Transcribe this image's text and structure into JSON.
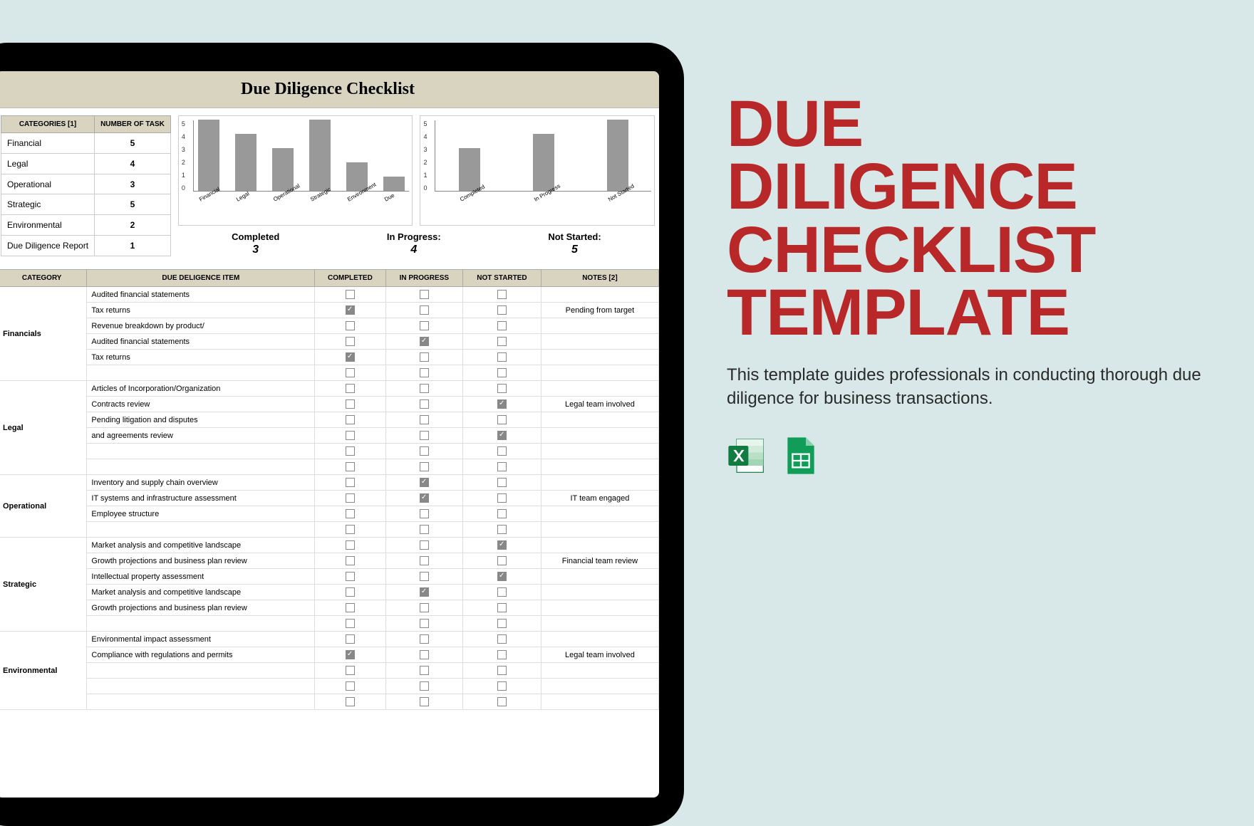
{
  "sheet": {
    "title": "Due Diligence Checklist",
    "summary": {
      "headers": [
        "CATEGORIES [1]",
        "NUMBER OF TASK"
      ],
      "rows": [
        {
          "cat": "Financial",
          "n": "5"
        },
        {
          "cat": "Legal",
          "n": "4"
        },
        {
          "cat": "Operational",
          "n": "3"
        },
        {
          "cat": "Strategic",
          "n": "5"
        },
        {
          "cat": "Environmental",
          "n": "2"
        },
        {
          "cat": "Due Diligence Report",
          "n": "1"
        }
      ]
    },
    "status": {
      "completed": {
        "label": "Completed",
        "val": "3"
      },
      "in_progress": {
        "label": "In Progress:",
        "val": "4"
      },
      "not_started": {
        "label": "Not Started:",
        "val": "5"
      }
    },
    "main_headers": [
      "CATEGORY",
      "DUE DELIGENCE ITEM",
      "COMPLETED",
      "IN PROGRESS",
      "NOT STARTED",
      "NOTES [2]"
    ],
    "groups": [
      {
        "name": "Financials",
        "rows": [
          {
            "item": "Audited financial statements",
            "c": false,
            "p": false,
            "n": false,
            "note": ""
          },
          {
            "item": "Tax returns",
            "c": true,
            "p": false,
            "n": false,
            "note": "Pending from target"
          },
          {
            "item": "Revenue breakdown by product/",
            "c": false,
            "p": false,
            "n": false,
            "note": ""
          },
          {
            "item": "Audited financial statements",
            "c": false,
            "p": true,
            "n": false,
            "note": ""
          },
          {
            "item": "Tax returns",
            "c": true,
            "p": false,
            "n": false,
            "note": ""
          },
          {
            "item": "",
            "c": false,
            "p": false,
            "n": false,
            "note": ""
          }
        ]
      },
      {
        "name": "Legal",
        "rows": [
          {
            "item": "Articles of Incorporation/Organization",
            "c": false,
            "p": false,
            "n": false,
            "note": ""
          },
          {
            "item": "Contracts review",
            "c": false,
            "p": false,
            "n": true,
            "note": "Legal team involved"
          },
          {
            "item": "Pending litigation and disputes",
            "c": false,
            "p": false,
            "n": false,
            "note": ""
          },
          {
            "item": "and agreements review",
            "c": false,
            "p": false,
            "n": true,
            "note": ""
          },
          {
            "item": "",
            "c": false,
            "p": false,
            "n": false,
            "note": ""
          },
          {
            "item": "",
            "c": false,
            "p": false,
            "n": false,
            "note": ""
          }
        ]
      },
      {
        "name": "Operational",
        "rows": [
          {
            "item": "Inventory and supply chain overview",
            "c": false,
            "p": true,
            "n": false,
            "note": ""
          },
          {
            "item": "IT systems and infrastructure assessment",
            "c": false,
            "p": true,
            "n": false,
            "note": "IT team engaged"
          },
          {
            "item": "Employee structure",
            "c": false,
            "p": false,
            "n": false,
            "note": ""
          },
          {
            "item": "",
            "c": false,
            "p": false,
            "n": false,
            "note": ""
          }
        ]
      },
      {
        "name": "Strategic",
        "rows": [
          {
            "item": "Market analysis and competitive landscape",
            "c": false,
            "p": false,
            "n": true,
            "note": ""
          },
          {
            "item": "Growth projections and business plan review",
            "c": false,
            "p": false,
            "n": false,
            "note": "Financial team review"
          },
          {
            "item": "Intellectual property assessment",
            "c": false,
            "p": false,
            "n": true,
            "note": ""
          },
          {
            "item": "Market analysis and competitive landscape",
            "c": false,
            "p": true,
            "n": false,
            "note": ""
          },
          {
            "item": "Growth projections and business plan review",
            "c": false,
            "p": false,
            "n": false,
            "note": ""
          },
          {
            "item": "",
            "c": false,
            "p": false,
            "n": false,
            "note": ""
          }
        ]
      },
      {
        "name": "Environmental",
        "rows": [
          {
            "item": "Environmental impact assessment",
            "c": false,
            "p": false,
            "n": false,
            "note": ""
          },
          {
            "item": "Compliance with regulations and permits",
            "c": true,
            "p": false,
            "n": false,
            "note": "Legal team involved"
          },
          {
            "item": "",
            "c": false,
            "p": false,
            "n": false,
            "note": ""
          },
          {
            "item": "",
            "c": false,
            "p": false,
            "n": false,
            "note": ""
          },
          {
            "item": "",
            "c": false,
            "p": false,
            "n": false,
            "note": ""
          }
        ]
      }
    ]
  },
  "chart_data": [
    {
      "type": "bar",
      "categories": [
        "Financial",
        "Legal",
        "Operational",
        "Strategic",
        "Environment",
        "Due"
      ],
      "values": [
        5,
        4,
        3,
        5,
        2,
        1
      ],
      "ylim": [
        0,
        5
      ]
    },
    {
      "type": "bar",
      "categories": [
        "Completed",
        "In Progress",
        "Not Started"
      ],
      "values": [
        3,
        4,
        5
      ],
      "ylim": [
        0,
        5
      ]
    }
  ],
  "promo": {
    "title": "DUE DILIGENCE CHECKLIST TEMPLATE",
    "subtitle": "This template guides professionals in conducting thorough due diligence for business transactions.",
    "icons": {
      "excel": "excel-icon",
      "sheets": "sheets-icon"
    }
  }
}
